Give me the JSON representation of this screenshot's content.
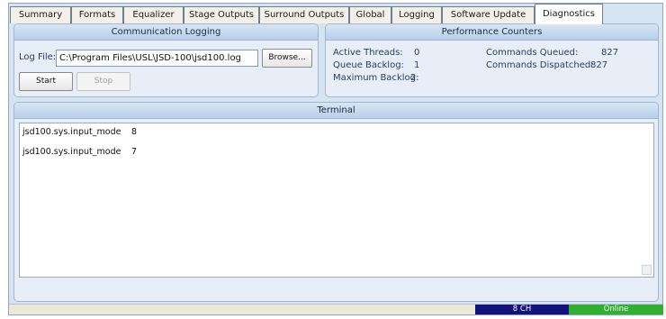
{
  "tabs": [
    {
      "label": "Summary"
    },
    {
      "label": "Formats"
    },
    {
      "label": "Equalizer"
    },
    {
      "label": "Stage Outputs"
    },
    {
      "label": "Surround Outputs"
    },
    {
      "label": "Global"
    },
    {
      "label": "Logging"
    },
    {
      "label": "Software Update"
    },
    {
      "label": "Diagnostics",
      "active": true
    }
  ],
  "communication_logging": {
    "title": "Communication Logging",
    "log_file_label": "Log File:",
    "log_file_value": "C:\\Program Files\\USL\\JSD-100\\jsd100.log",
    "browse_label": "Browse...",
    "start_label": "Start",
    "stop_label": "Stop"
  },
  "performance_counters": {
    "title": "Performance Counters",
    "active_threads_label": "Active Threads:",
    "active_threads_value": "0",
    "queue_backlog_label": "Queue Backlog:",
    "queue_backlog_value": "1",
    "maximum_backlog_label": "Maximum Backlog:",
    "maximum_backlog_value": "2",
    "commands_queued_label": "Commands Queued:",
    "commands_queued_value": "827",
    "commands_dispatched_label": "Commands Dispatched:",
    "commands_dispatched_value": "827"
  },
  "terminal": {
    "title": "Terminal",
    "lines": [
      {
        "key": "jsd100.sys.input_mode",
        "value": "8"
      },
      {
        "key": "jsd100.sys.input_mode",
        "value": "7"
      }
    ]
  },
  "status_bar": {
    "channels": "8 CH",
    "connection": "Online"
  },
  "colors": {
    "tab_background": "#f3f1e7",
    "panel_header": "#b8cfe8",
    "channels_badge": "#12127a",
    "online_badge": "#2fb02f"
  }
}
